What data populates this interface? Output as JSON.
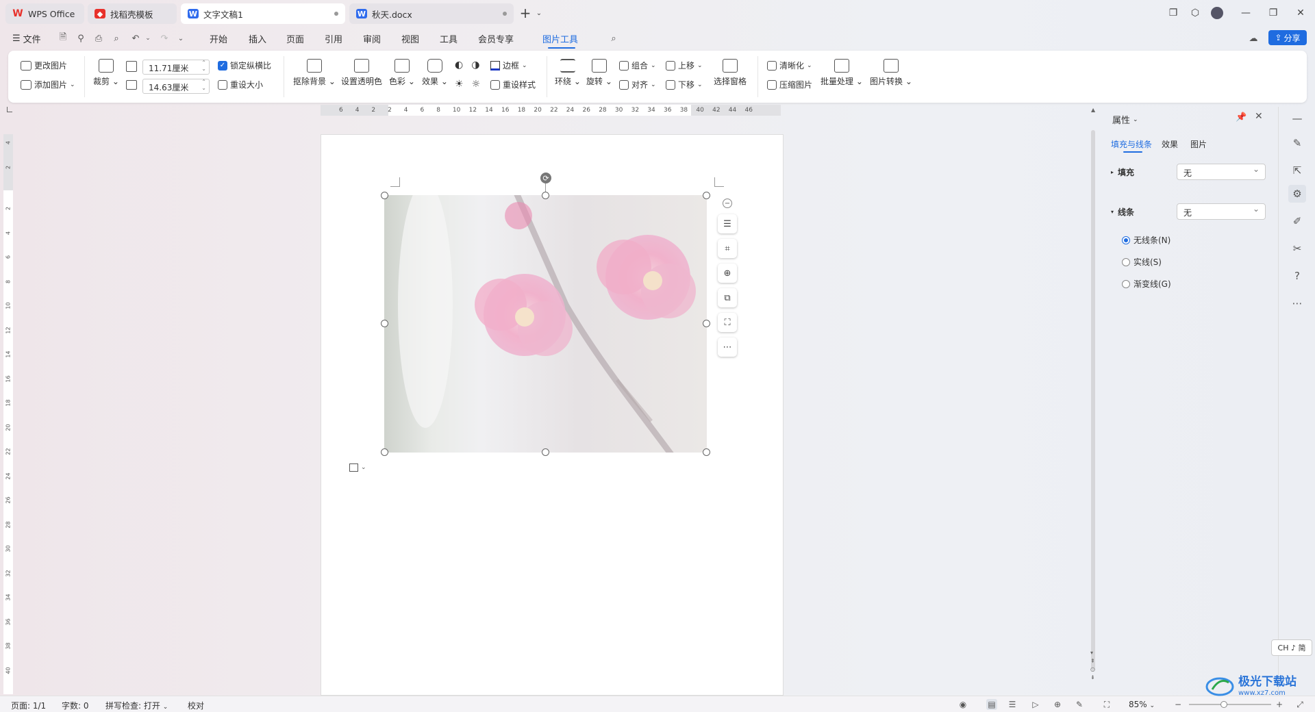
{
  "tabs": [
    {
      "label": "WPS Office",
      "logo": "W"
    },
    {
      "label": "找稻壳模板",
      "logo": "稻"
    },
    {
      "label": "文字文稿1",
      "logo": "W"
    },
    {
      "label": "秋天.docx",
      "logo": "W"
    }
  ],
  "menu": {
    "file": "文件",
    "items": [
      "开始",
      "插入",
      "页面",
      "引用",
      "审阅",
      "视图",
      "工具",
      "会员专享",
      "图片工具"
    ],
    "share": "分享"
  },
  "ribbon": {
    "change_pic": "更改图片",
    "add_pic": "添加图片",
    "crop": "裁剪",
    "width": "11.71厘米",
    "height": "14.63厘米",
    "lock_ratio": "锁定纵横比",
    "reset_size": "重设大小",
    "remove_bg": "抠除背景",
    "set_transparent": "设置透明色",
    "color": "色彩",
    "effects": "效果",
    "border": "边框",
    "reset_style": "重设样式",
    "wrap": "环绕",
    "rotate": "旋转",
    "group": "组合",
    "align": "对齐",
    "move_up": "上移",
    "move_down": "下移",
    "select_pane": "选择窗格",
    "clarity": "清晰化",
    "compress": "压缩图片",
    "batch": "批量处理",
    "convert": "图片转换"
  },
  "ruler_h": [
    "6",
    "4",
    "2",
    "2",
    "4",
    "6",
    "8",
    "10",
    "12",
    "14",
    "16",
    "18",
    "20",
    "22",
    "24",
    "26",
    "28",
    "30",
    "32",
    "34",
    "36",
    "38",
    "40",
    "42",
    "44",
    "46"
  ],
  "ruler_v": [
    "4",
    "2",
    "2",
    "4",
    "6",
    "8",
    "10",
    "12",
    "14",
    "16",
    "18",
    "20",
    "22",
    "24",
    "26",
    "28",
    "30",
    "32",
    "34",
    "36",
    "38",
    "40"
  ],
  "props": {
    "title": "属性",
    "tabs": [
      "填充与线条",
      "效果",
      "图片"
    ],
    "fill_label": "填充",
    "fill_value": "无",
    "line_label": "线条",
    "line_value": "无",
    "radios": [
      "无线条(N)",
      "实线(S)",
      "渐变线(G)"
    ]
  },
  "ime": "CH ♪ 简",
  "status": {
    "page": "页面: 1/1",
    "words": "字数: 0",
    "spell": "拼写检查: 打开",
    "proof": "校对",
    "zoom": "85%"
  },
  "watermark": "极光下载站",
  "watermark_url": "www.xz7.com",
  "colors": {
    "accent": "#1f6ce0",
    "wps_red": "#e8312b"
  }
}
